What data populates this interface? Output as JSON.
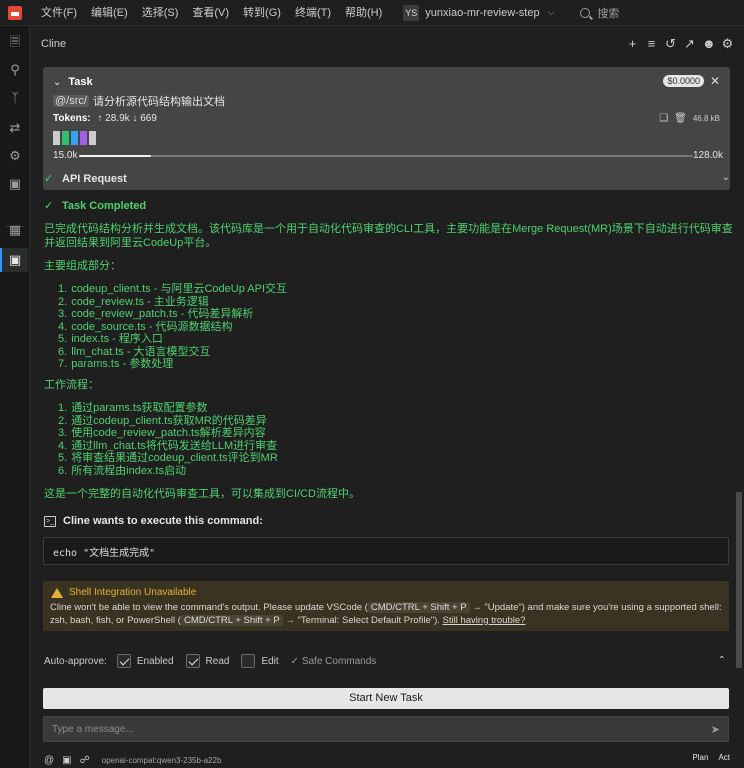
{
  "menubar": {
    "items": [
      "文件(F)",
      "编辑(E)",
      "选择(S)",
      "查看(V)",
      "转到(G)",
      "终端(T)",
      "帮助(H)"
    ],
    "workspace_badge": "YS",
    "workspace_name": "yunxiao-mr-review-step",
    "search_placeholder": "搜索"
  },
  "activity_icons": [
    "files-icon",
    "search-icon",
    "source-control-icon",
    "remote-icon",
    "debug-icon",
    "testing-icon",
    "extensions-icon",
    "cline-icon"
  ],
  "panel": {
    "title": "Cline"
  },
  "task": {
    "label": "Task",
    "cost": "$0.0000",
    "mention": "@/src/",
    "text": "请分析源代码结构输出文档",
    "tokens_label": "Tokens:",
    "tokens_in": "↑ 28.9k",
    "tokens_out": "↓ 669",
    "size": "46.8 kB",
    "context_used": "15.0k",
    "context_max": "128.0k",
    "context_fraction": 0.117,
    "cache_colors": [
      "#cccccc",
      "#30c070",
      "#3aa0f0",
      "#a060e0",
      "#cccccc"
    ]
  },
  "chat": {
    "api_request": "API Request",
    "task_completed": "Task Completed",
    "summary": "已完成代码结构分析并生成文档。该代码库是一个用于自动化代码审查的CLI工具，主要功能是在Merge Request(MR)场景下自动进行代码审查并返回结果到阿里云CodeUp平台。",
    "components_title": "主要组成部分：",
    "components": [
      "codeup_client.ts - 与阿里云CodeUp API交互",
      "code_review.ts - 主业务逻辑",
      "code_review_patch.ts - 代码差异解析",
      "code_source.ts - 代码源数据结构",
      "index.ts - 程序入口",
      "llm_chat.ts - 大语言模型交互",
      "params.ts - 参数处理"
    ],
    "workflow_title": "工作流程：",
    "workflow": [
      "通过params.ts获取配置参数",
      "通过codeup_client.ts获取MR的代码差异",
      "使用code_review_patch.ts解析差异内容",
      "通过llm_chat.ts将代码发送给LLM进行审查",
      "将审查结果通过codeup_client.ts评论到MR",
      "所有流程由index.ts启动"
    ],
    "conclusion": "这是一个完整的自动化代码审查工具，可以集成到CI/CD流程中。",
    "command_title": "Cline wants to execute this command:",
    "command": "echo \"文档生成完成\"",
    "warning": {
      "title": "Shell Integration Unavailable",
      "text_1": "Cline won't be able to view the command's output. Please update VSCode (",
      "kbd_1": "CMD/CTRL + Shift + P",
      "text_2": " → \"Update\") and make sure you're using a supported shell: zsh, bash, fish, or PowerShell (",
      "kbd_2": "CMD/CTRL + Shift + P",
      "text_3": " → \"Terminal: Select Default Profile\"). ",
      "link": "Still having trouble?"
    }
  },
  "auto_approve": {
    "label": "Auto-approve:",
    "enabled_label": "Enabled",
    "read_label": "Read",
    "edit_label": "Edit",
    "safe_label": "✓ Safe Commands"
  },
  "start_new_task": "Start New Task",
  "message_placeholder": "Type a message...",
  "footer": {
    "model": "openai-compat:qwen3-235b-a22b",
    "plan": "Plan",
    "act": "Act"
  }
}
